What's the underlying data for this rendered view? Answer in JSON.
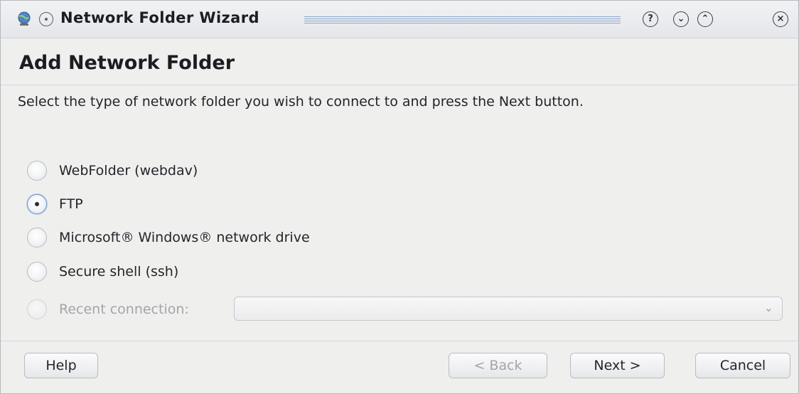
{
  "window": {
    "title": "Network Folder Wizard"
  },
  "titlebar": {
    "app_icon": "network-globe-icon",
    "buttons": [
      {
        "name": "help",
        "glyph": "?"
      },
      {
        "name": "minimize",
        "glyph": "⌄"
      },
      {
        "name": "maximize",
        "glyph": "⌃"
      },
      {
        "name": "close",
        "glyph": "×"
      }
    ]
  },
  "page": {
    "title": "Add Network Folder",
    "instructions": "Select the type of network folder you wish to connect to and press the Next button."
  },
  "options": [
    {
      "label": "WebFolder (webdav)",
      "checked": false,
      "enabled": true
    },
    {
      "label": "FTP",
      "checked": true,
      "enabled": true
    },
    {
      "label": "Microsoft® Windows® network drive",
      "checked": false,
      "enabled": true
    },
    {
      "label": "Secure shell (ssh)",
      "checked": false,
      "enabled": true
    },
    {
      "label": "Recent connection:",
      "checked": false,
      "enabled": false
    }
  ],
  "recent_combo": {
    "value": "",
    "arrow": "⌄"
  },
  "buttons": {
    "help": "Help",
    "back": "< Back",
    "next": "Next >",
    "cancel": "Cancel"
  },
  "colors": {
    "accent": "#6d97cf",
    "title_lines": "#8ca6c8"
  }
}
